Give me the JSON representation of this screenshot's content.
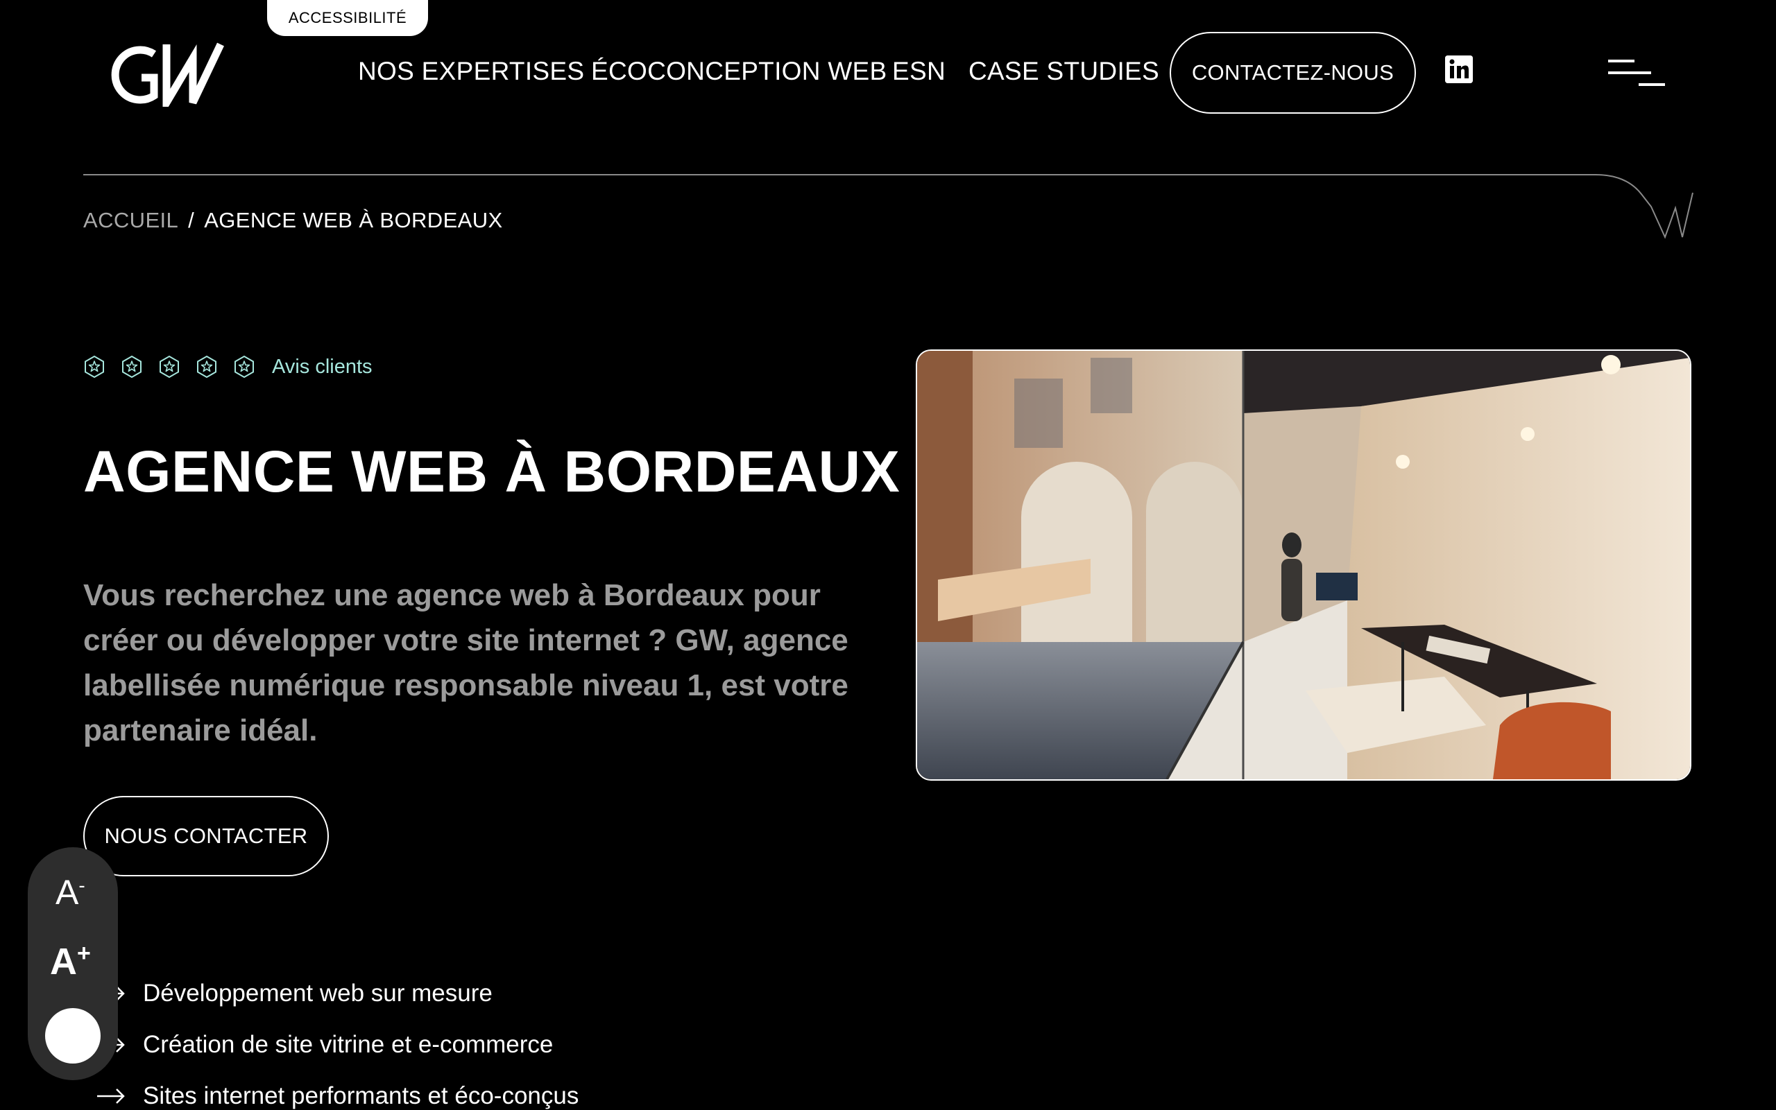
{
  "accessibility_tab": "ACCESSIBILITÉ",
  "nav": {
    "items": [
      "NOS EXPERTISES",
      "ÉCOCONCEPTION WEB",
      "ESN",
      "CASE STUDIES"
    ],
    "contact_label": "CONTACTEZ-NOUS",
    "social_icon": "linkedin-icon",
    "menu_icon": "hamburger-menu-icon"
  },
  "breadcrumb": {
    "home": "ACCUEIL",
    "separator": "/",
    "current": "AGENCE WEB À BORDEAUX"
  },
  "hero": {
    "rating_icon": "star-badge-icon",
    "rating_count": 5,
    "reviews_label": "Avis clients",
    "title": "AGENCE WEB À BORDEAUX",
    "intro": "Vous recherchez une agence web à Bordeaux pour créer ou développer votre site internet ? GW, agence labellisée numérique responsable niveau 1, est votre partenaire idéal.",
    "cta_label": "NOUS CONTACTER"
  },
  "features": [
    "Développement web sur mesure",
    "Création de site vitrine et e-commerce",
    "Sites internet performants et éco-conçus"
  ],
  "font_widget": {
    "decrease_label": "A",
    "decrease_sup": "-",
    "increase_label": "A",
    "increase_sup": "+"
  },
  "colors": {
    "background": "#000000",
    "text": "#ffffff",
    "muted_text": "#9b9b9b",
    "accent_mint": "#a6e6dd",
    "widget_bg": "#2d2d2d"
  }
}
